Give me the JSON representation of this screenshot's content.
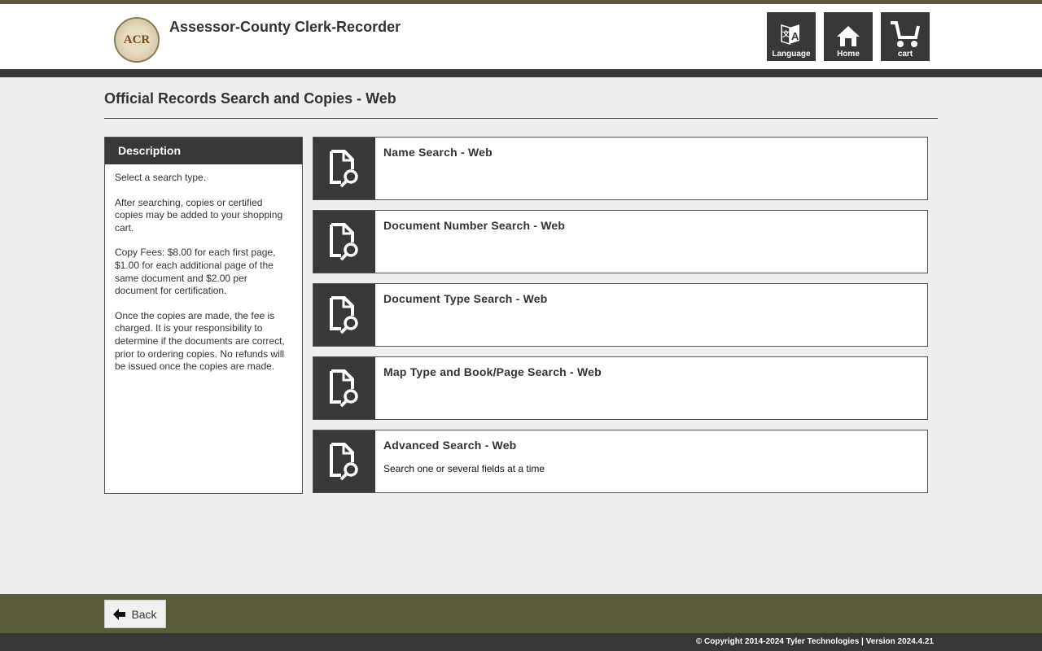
{
  "header": {
    "title": "Assessor-County Clerk-Recorder",
    "logo_text": "ACR",
    "buttons": [
      {
        "label": "Language",
        "icon": "language-icon"
      },
      {
        "label": "Home",
        "icon": "home-icon"
      },
      {
        "label": "cart",
        "icon": "cart-icon"
      }
    ]
  },
  "page_title": "Official Records Search and Copies - Web",
  "description": {
    "heading": "Description",
    "paragraphs": [
      "Select a search type.",
      "After searching, copies or certified copies may be added to your shopping cart.",
      "Copy Fees: $8.00 for each first page, $1.00 for each additional page of the same document and $2.00 per document for certification.",
      "Once the copies are made, the fee is charged. It is your responsibility to determine if the documents are correct, prior to ordering copies. No refunds will be issued once the copies are made."
    ]
  },
  "searches": [
    {
      "title": "Name Search - Web",
      "subtitle": ""
    },
    {
      "title": "Document Number Search - Web",
      "subtitle": ""
    },
    {
      "title": "Document Type Search - Web",
      "subtitle": ""
    },
    {
      "title": "Map Type and Book/Page Search - Web",
      "subtitle": ""
    },
    {
      "title": "Advanced Search - Web",
      "subtitle": "Search one or several fields at a time"
    }
  ],
  "footer": {
    "back_label": "Back",
    "copyright": "© Copyright 2014-2024 Tyler Technologies | Version 2024.4.21"
  }
}
